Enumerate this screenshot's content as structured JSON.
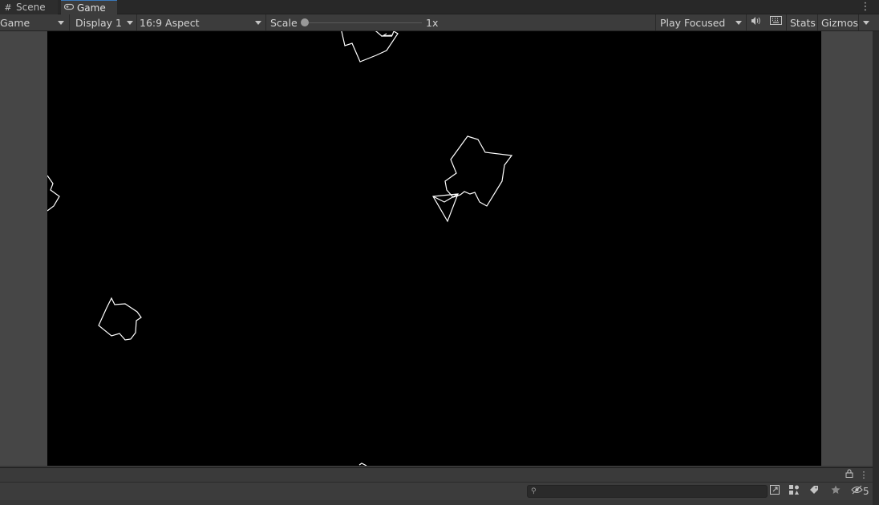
{
  "tabs": [
    {
      "label": "Scene",
      "icon": "grid-icon"
    },
    {
      "label": "Game",
      "icon": "gamepad-icon"
    }
  ],
  "toolbar": {
    "game_mode": "Game",
    "display": "Display 1",
    "aspect": "16:9 Aspect",
    "scale_label": "Scale",
    "scale_value": "1x",
    "scale_fraction": 0.0,
    "play_mode": "Play Focused",
    "stats_label": "Stats",
    "gizmos_label": "Gizmos"
  },
  "hierarchy": {
    "search_placeholder": "",
    "hidden_count": "5"
  },
  "colors": {
    "game_background": "#000000",
    "asteroid_stroke": "#ffffff",
    "panel": "#3c3c3c",
    "tab_accent": "#3a79bb"
  }
}
